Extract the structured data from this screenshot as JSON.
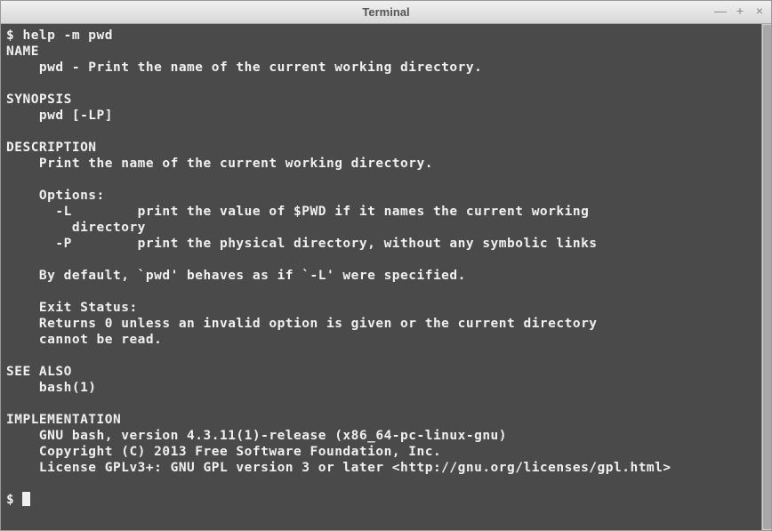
{
  "window": {
    "title": "Terminal"
  },
  "terminal": {
    "prompt1": "$ ",
    "command1": "help -m pwd",
    "name_header": "NAME",
    "name_line": "    pwd - Print the name of the current working directory.",
    "synopsis_header": "SYNOPSIS",
    "synopsis_line": "    pwd [-LP]",
    "description_header": "DESCRIPTION",
    "desc_line1": "    Print the name of the current working directory.",
    "desc_options": "    Options:",
    "desc_L1": "      -L        print the value of $PWD if it names the current working",
    "desc_L2": "        directory",
    "desc_P": "      -P        print the physical directory, without any symbolic links",
    "desc_default": "    By default, `pwd' behaves as if `-L' were specified.",
    "desc_exit_header": "    Exit Status:",
    "desc_exit1": "    Returns 0 unless an invalid option is given or the current directory",
    "desc_exit2": "    cannot be read.",
    "seealso_header": "SEE ALSO",
    "seealso_line": "    bash(1)",
    "impl_header": "IMPLEMENTATION",
    "impl_line1": "    GNU bash, version 4.3.11(1)-release (x86_64-pc-linux-gnu)",
    "impl_line2": "    Copyright (C) 2013 Free Software Foundation, Inc.",
    "impl_line3": "    License GPLv3+: GNU GPL version 3 or later <http://gnu.org/licenses/gpl.html>",
    "prompt2": "$ "
  }
}
